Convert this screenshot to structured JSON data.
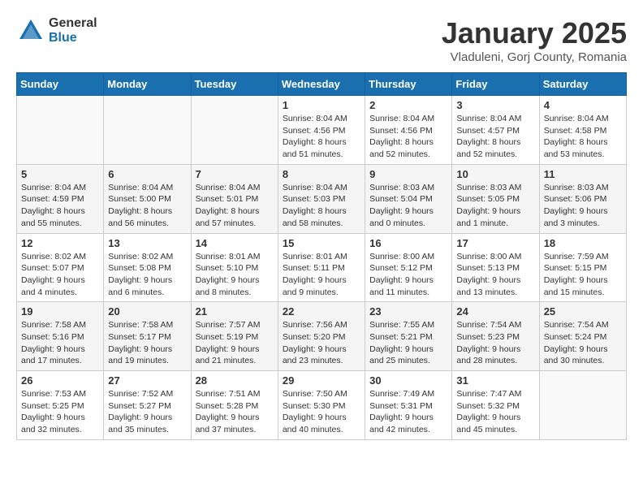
{
  "header": {
    "logo_general": "General",
    "logo_blue": "Blue",
    "month_title": "January 2025",
    "subtitle": "Vladuleni, Gorj County, Romania"
  },
  "weekdays": [
    "Sunday",
    "Monday",
    "Tuesday",
    "Wednesday",
    "Thursday",
    "Friday",
    "Saturday"
  ],
  "weeks": [
    {
      "days": [
        {
          "num": "",
          "info": ""
        },
        {
          "num": "",
          "info": ""
        },
        {
          "num": "",
          "info": ""
        },
        {
          "num": "1",
          "info": "Sunrise: 8:04 AM\nSunset: 4:56 PM\nDaylight: 8 hours\nand 51 minutes."
        },
        {
          "num": "2",
          "info": "Sunrise: 8:04 AM\nSunset: 4:56 PM\nDaylight: 8 hours\nand 52 minutes."
        },
        {
          "num": "3",
          "info": "Sunrise: 8:04 AM\nSunset: 4:57 PM\nDaylight: 8 hours\nand 52 minutes."
        },
        {
          "num": "4",
          "info": "Sunrise: 8:04 AM\nSunset: 4:58 PM\nDaylight: 8 hours\nand 53 minutes."
        }
      ]
    },
    {
      "days": [
        {
          "num": "5",
          "info": "Sunrise: 8:04 AM\nSunset: 4:59 PM\nDaylight: 8 hours\nand 55 minutes."
        },
        {
          "num": "6",
          "info": "Sunrise: 8:04 AM\nSunset: 5:00 PM\nDaylight: 8 hours\nand 56 minutes."
        },
        {
          "num": "7",
          "info": "Sunrise: 8:04 AM\nSunset: 5:01 PM\nDaylight: 8 hours\nand 57 minutes."
        },
        {
          "num": "8",
          "info": "Sunrise: 8:04 AM\nSunset: 5:03 PM\nDaylight: 8 hours\nand 58 minutes."
        },
        {
          "num": "9",
          "info": "Sunrise: 8:03 AM\nSunset: 5:04 PM\nDaylight: 9 hours\nand 0 minutes."
        },
        {
          "num": "10",
          "info": "Sunrise: 8:03 AM\nSunset: 5:05 PM\nDaylight: 9 hours\nand 1 minute."
        },
        {
          "num": "11",
          "info": "Sunrise: 8:03 AM\nSunset: 5:06 PM\nDaylight: 9 hours\nand 3 minutes."
        }
      ]
    },
    {
      "days": [
        {
          "num": "12",
          "info": "Sunrise: 8:02 AM\nSunset: 5:07 PM\nDaylight: 9 hours\nand 4 minutes."
        },
        {
          "num": "13",
          "info": "Sunrise: 8:02 AM\nSunset: 5:08 PM\nDaylight: 9 hours\nand 6 minutes."
        },
        {
          "num": "14",
          "info": "Sunrise: 8:01 AM\nSunset: 5:10 PM\nDaylight: 9 hours\nand 8 minutes."
        },
        {
          "num": "15",
          "info": "Sunrise: 8:01 AM\nSunset: 5:11 PM\nDaylight: 9 hours\nand 9 minutes."
        },
        {
          "num": "16",
          "info": "Sunrise: 8:00 AM\nSunset: 5:12 PM\nDaylight: 9 hours\nand 11 minutes."
        },
        {
          "num": "17",
          "info": "Sunrise: 8:00 AM\nSunset: 5:13 PM\nDaylight: 9 hours\nand 13 minutes."
        },
        {
          "num": "18",
          "info": "Sunrise: 7:59 AM\nSunset: 5:15 PM\nDaylight: 9 hours\nand 15 minutes."
        }
      ]
    },
    {
      "days": [
        {
          "num": "19",
          "info": "Sunrise: 7:58 AM\nSunset: 5:16 PM\nDaylight: 9 hours\nand 17 minutes."
        },
        {
          "num": "20",
          "info": "Sunrise: 7:58 AM\nSunset: 5:17 PM\nDaylight: 9 hours\nand 19 minutes."
        },
        {
          "num": "21",
          "info": "Sunrise: 7:57 AM\nSunset: 5:19 PM\nDaylight: 9 hours\nand 21 minutes."
        },
        {
          "num": "22",
          "info": "Sunrise: 7:56 AM\nSunset: 5:20 PM\nDaylight: 9 hours\nand 23 minutes."
        },
        {
          "num": "23",
          "info": "Sunrise: 7:55 AM\nSunset: 5:21 PM\nDaylight: 9 hours\nand 25 minutes."
        },
        {
          "num": "24",
          "info": "Sunrise: 7:54 AM\nSunset: 5:23 PM\nDaylight: 9 hours\nand 28 minutes."
        },
        {
          "num": "25",
          "info": "Sunrise: 7:54 AM\nSunset: 5:24 PM\nDaylight: 9 hours\nand 30 minutes."
        }
      ]
    },
    {
      "days": [
        {
          "num": "26",
          "info": "Sunrise: 7:53 AM\nSunset: 5:25 PM\nDaylight: 9 hours\nand 32 minutes."
        },
        {
          "num": "27",
          "info": "Sunrise: 7:52 AM\nSunset: 5:27 PM\nDaylight: 9 hours\nand 35 minutes."
        },
        {
          "num": "28",
          "info": "Sunrise: 7:51 AM\nSunset: 5:28 PM\nDaylight: 9 hours\nand 37 minutes."
        },
        {
          "num": "29",
          "info": "Sunrise: 7:50 AM\nSunset: 5:30 PM\nDaylight: 9 hours\nand 40 minutes."
        },
        {
          "num": "30",
          "info": "Sunrise: 7:49 AM\nSunset: 5:31 PM\nDaylight: 9 hours\nand 42 minutes."
        },
        {
          "num": "31",
          "info": "Sunrise: 7:47 AM\nSunset: 5:32 PM\nDaylight: 9 hours\nand 45 minutes."
        },
        {
          "num": "",
          "info": ""
        }
      ]
    }
  ]
}
